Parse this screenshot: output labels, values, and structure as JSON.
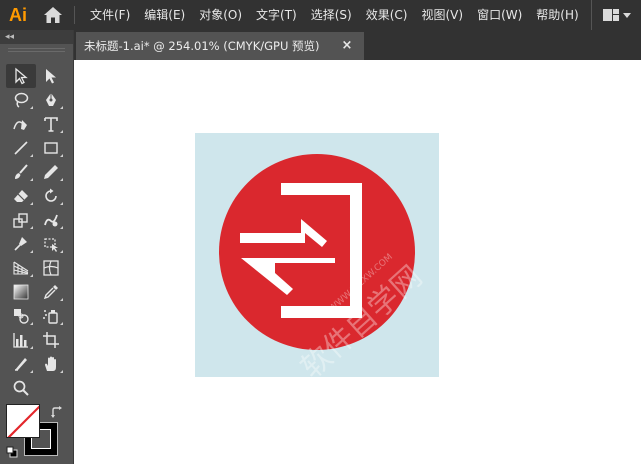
{
  "app": {
    "logo_text": "Ai",
    "logo_color": "#FF9A00"
  },
  "menu": {
    "items": [
      {
        "label": "文件(F)"
      },
      {
        "label": "编辑(E)"
      },
      {
        "label": "对象(O)"
      },
      {
        "label": "文字(T)"
      },
      {
        "label": "选择(S)"
      },
      {
        "label": "效果(C)"
      },
      {
        "label": "视图(V)"
      },
      {
        "label": "窗口(W)"
      },
      {
        "label": "帮助(H)"
      }
    ]
  },
  "toolbar": {
    "collapse_label": "◂◂",
    "tools": [
      {
        "name": "selection-tool-icon",
        "active": true
      },
      {
        "name": "direct-selection-tool-icon"
      },
      {
        "name": "lasso-tool-icon"
      },
      {
        "name": "pen-tool-icon"
      },
      {
        "name": "curvature-tool-icon"
      },
      {
        "name": "type-tool-icon"
      },
      {
        "name": "line-segment-tool-icon"
      },
      {
        "name": "rectangle-tool-icon"
      },
      {
        "name": "paintbrush-tool-icon"
      },
      {
        "name": "pencil-tool-icon"
      },
      {
        "name": "eraser-tool-icon"
      },
      {
        "name": "rotate-tool-icon"
      },
      {
        "name": "scale-tool-icon"
      },
      {
        "name": "warp-tool-icon"
      },
      {
        "name": "puppet-warp-tool-icon"
      },
      {
        "name": "free-transform-tool-icon"
      },
      {
        "name": "perspective-grid-tool-icon"
      },
      {
        "name": "mesh-tool-icon"
      },
      {
        "name": "gradient-tool-icon"
      },
      {
        "name": "eyedropper-tool-icon"
      },
      {
        "name": "blend-tool-icon"
      },
      {
        "name": "symbol-sprayer-tool-icon"
      },
      {
        "name": "column-graph-tool-icon"
      },
      {
        "name": "artboard-tool-icon"
      },
      {
        "name": "slice-tool-icon"
      },
      {
        "name": "hand-tool-icon"
      },
      {
        "name": "zoom-tool-icon"
      }
    ]
  },
  "document": {
    "tab_title": "未标题-1.ai* @ 254.01% (CMYK/GPU 预览)",
    "close_label": "×"
  },
  "artwork": {
    "background_color": "#CFE6EC",
    "circle_color": "#DA282E",
    "arrow_color": "#FFFFFF",
    "watermark_text": "软件自学网",
    "watermark_url": "WWW.RJZXW.COM"
  }
}
